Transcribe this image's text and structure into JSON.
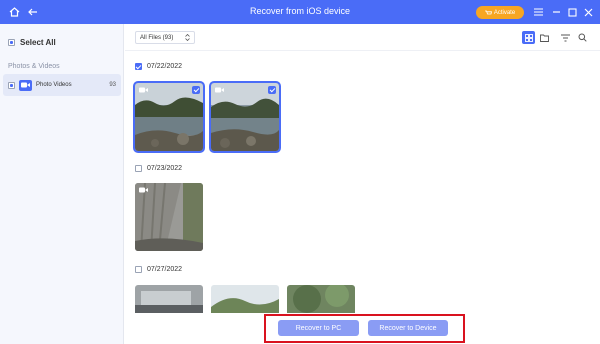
{
  "app": {
    "title": "Recover from iOS device",
    "activate_label": "Activate"
  },
  "icons": {
    "home": "home-icon",
    "back": "back-arrow-icon",
    "menu": "menu-icon",
    "minimize": "minimize-icon",
    "maximize": "maximize-icon",
    "close": "close-icon",
    "grid_view": "grid-view-icon",
    "folder_view": "folder-view-icon",
    "filter": "filter-icon",
    "search": "search-icon",
    "video": "video-camera-icon"
  },
  "colors": {
    "accent": "#4a6cf7",
    "activate": "#f7a623",
    "highlight_box": "#d9121f",
    "button": "#8a9cf4"
  },
  "sidebar": {
    "select_all": "Select All",
    "section_title": "Photos & Videos",
    "items": [
      {
        "label": "Photo Videos",
        "count": "93"
      }
    ]
  },
  "toolbar": {
    "filter_value": "All Files (93)"
  },
  "groups": [
    {
      "date": "07/22/2022",
      "checked": true
    },
    {
      "date": "07/23/2022",
      "checked": false
    },
    {
      "date": "07/27/2022",
      "checked": false
    }
  ],
  "actions": {
    "recover_pc": "Recover to PC",
    "recover_device": "Recover to Device"
  }
}
